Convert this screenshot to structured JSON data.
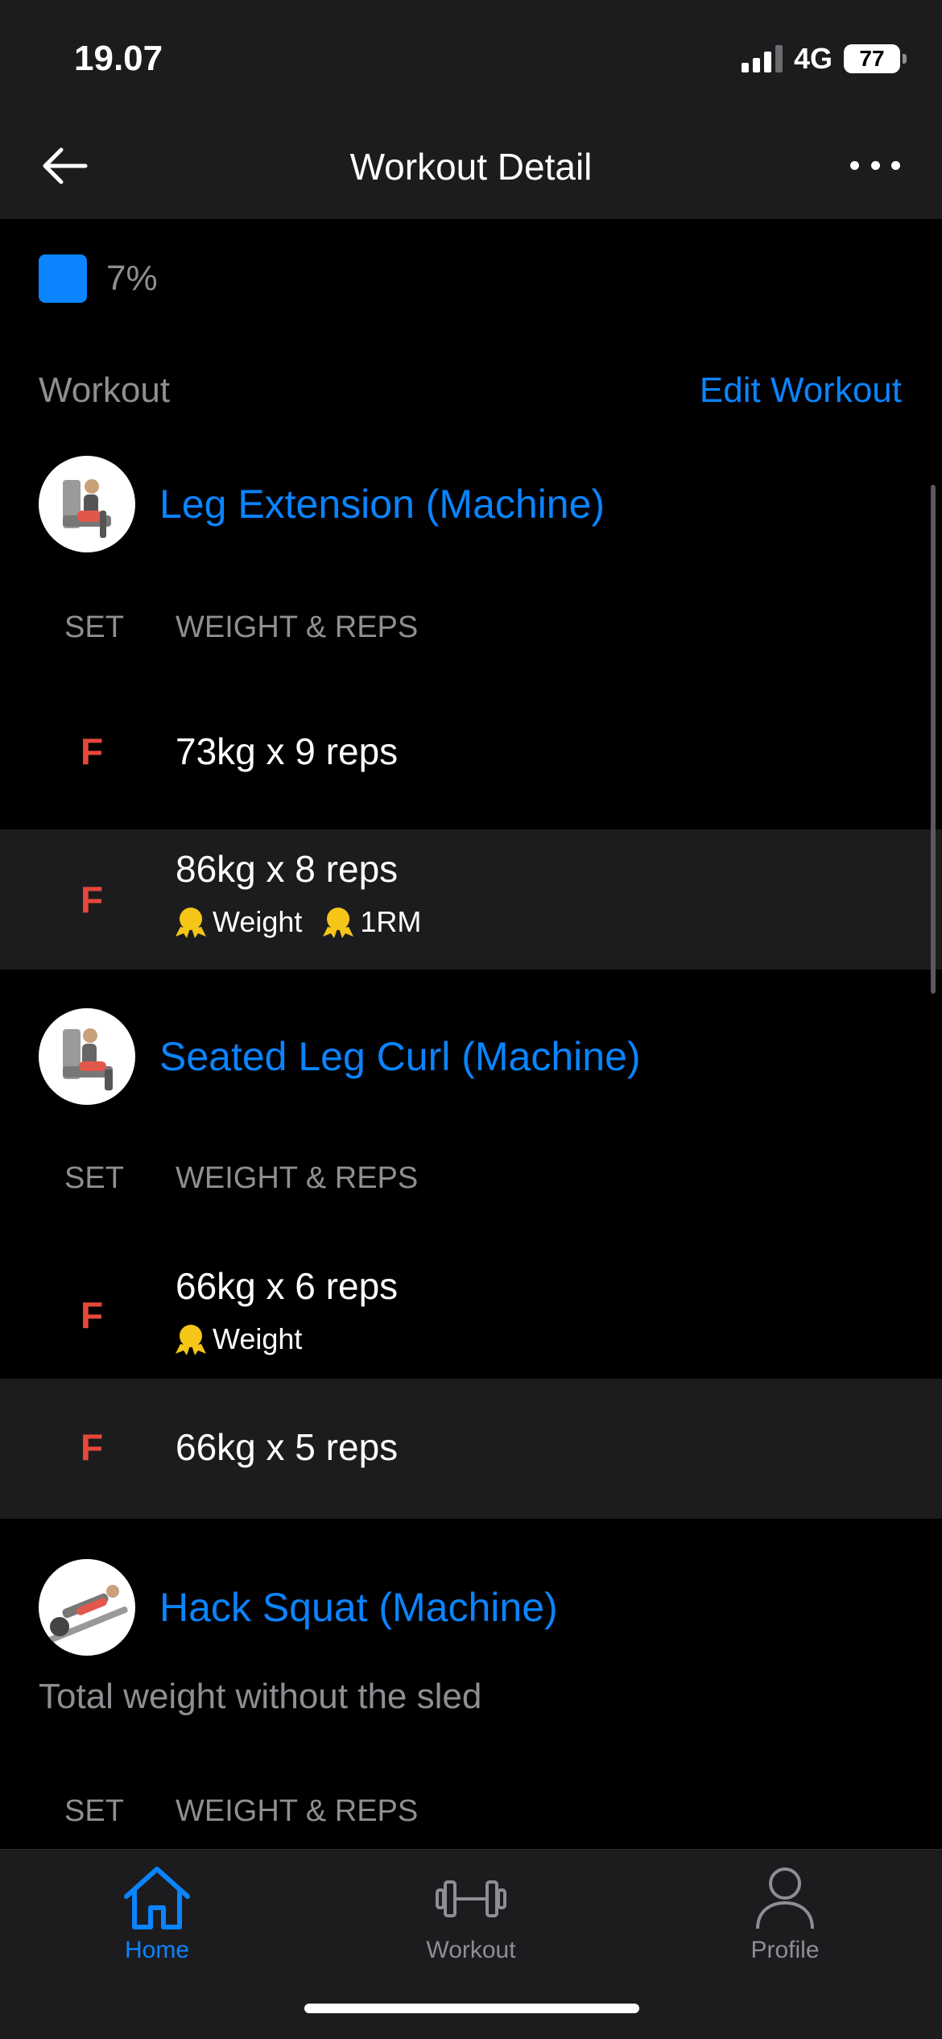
{
  "status_bar": {
    "time": "19.07",
    "network": "4G",
    "battery": "77"
  },
  "nav": {
    "title": "Workout Detail"
  },
  "muscle_split": {
    "cut_label": "Back",
    "percent": "7%",
    "swatch_color": "#0a84ff"
  },
  "section": {
    "title": "Workout",
    "edit_label": "Edit Workout"
  },
  "columns": {
    "set": "SET",
    "weight_reps": "WEIGHT & REPS"
  },
  "exercises": [
    {
      "name": "Leg Extension (Machine)",
      "sets": [
        {
          "tag": "F",
          "value": "73kg x 9 reps"
        },
        {
          "tag": "F",
          "value": "86kg x 8 reps",
          "badges": [
            "Weight",
            "1RM"
          ]
        }
      ]
    },
    {
      "name": "Seated Leg Curl (Machine)",
      "sets": [
        {
          "tag": "F",
          "value": "66kg x 6 reps",
          "badges": [
            "Weight"
          ]
        },
        {
          "tag": "F",
          "value": "66kg x 5 reps"
        }
      ]
    },
    {
      "name": "Hack Squat (Machine)",
      "note": "Total weight without the sled"
    }
  ],
  "tabs": [
    {
      "label": "Home",
      "icon": "home-icon",
      "active": true
    },
    {
      "label": "Workout",
      "icon": "dumbbell-icon",
      "active": false
    },
    {
      "label": "Profile",
      "icon": "person-icon",
      "active": false
    }
  ],
  "colors": {
    "accent": "#0a84ff",
    "set_tag": "#e5483a",
    "medal": "#f5c518"
  }
}
